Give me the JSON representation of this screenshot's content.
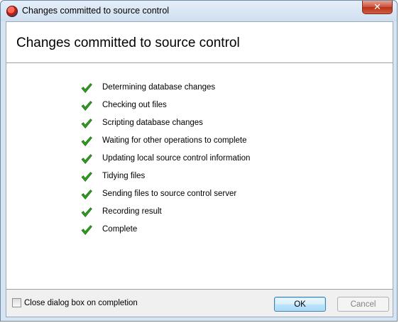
{
  "window": {
    "title": "Changes committed to source control",
    "close_label": "✕"
  },
  "header": {
    "title": "Changes committed to source control"
  },
  "steps": [
    {
      "label": "Determining database changes",
      "status": "done"
    },
    {
      "label": "Checking out files",
      "status": "done"
    },
    {
      "label": "Scripting database changes",
      "status": "done"
    },
    {
      "label": "Waiting for other operations to complete",
      "status": "done"
    },
    {
      "label": "Updating local source control information",
      "status": "done"
    },
    {
      "label": "Tidying files",
      "status": "done"
    },
    {
      "label": "Sending files to source control server",
      "status": "done"
    },
    {
      "label": "Recording result",
      "status": "done"
    },
    {
      "label": "Complete",
      "status": "done"
    }
  ],
  "footer": {
    "close_on_completion_label": "Close dialog box on completion",
    "close_on_completion_checked": false,
    "ok_label": "OK",
    "cancel_label": "Cancel",
    "cancel_enabled": false
  },
  "colors": {
    "check": "#2e9a20",
    "accent": "#3c7fb1"
  }
}
